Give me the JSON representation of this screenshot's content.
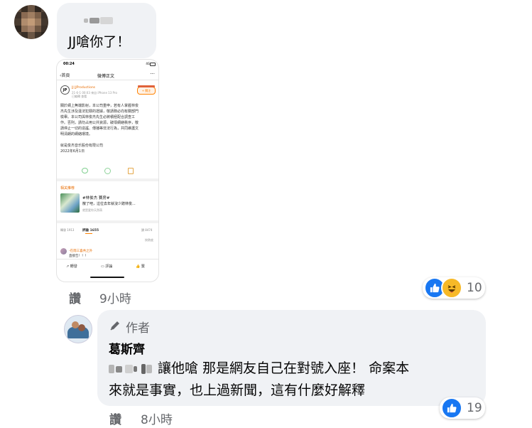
{
  "comment1": {
    "author_censored": true,
    "text": "JJ嗆你了！",
    "action_label": "讚",
    "timestamp": "9小時",
    "reaction_count": "10",
    "reaction_icons": [
      "like-icon",
      "haha-icon"
    ]
  },
  "screenshot": {
    "status_time": "00:24",
    "status_right": "4G",
    "back_label": "首頁",
    "page_title": "微博正文",
    "more_label": "···",
    "account_name": "JJ JJProductions",
    "post_meta": "21-6-1 00:03 來自 iPhone 13 Pro",
    "post_meta2": "已編輯 查看",
    "follow_label": "+ 關注",
    "body_lines": [
      "關於網上無端影射，本公司重申，若有人掌握林俊",
      "杰先生涉及違法犯罪的證據，敬請務必向有關部門",
      "檢舉。本公司與林俊杰先生必將積極配合調查工",
      "作。否則，請勿占用公共資源，破壞網絡秩序，敬",
      "請停止一切的造謠、傳播等非法行為，共同維護文",
      "明清朗的網絡環境。"
    ],
    "company": "就是俊杰音乐股份有限公司",
    "date": "2022年6月1日",
    "related_label": "相关推荐",
    "related_title": "#林俊杰 賽房#",
    "related_sub": "散了吧，這位去年就沒少蹭林俊...",
    "related_meta": "就是愛你天然萌",
    "tab_repost": "轉發 1913",
    "tab_comment": "評論 1655",
    "tab_like": "讚 8474",
    "sort_label": "按熱度",
    "comment_user": "-在雨三喜共之外",
    "comment_text": "直接告！！！",
    "bottom_repost": "轉發",
    "bottom_comment": "評論",
    "bottom_like": "贊"
  },
  "comment2": {
    "author_badge": "作者",
    "author_name": "葛斯齊",
    "text_line1": "讓他嗆 那是網友自己在對號入座！ 命案本",
    "text_line2": "來就是事實，也上過新聞，這有什麼好解釋",
    "action_label": "讚",
    "timestamp": "8小時",
    "reaction_count": "19",
    "reaction_icons": [
      "like-icon"
    ]
  },
  "colors": {
    "like_blue": "#1877f2",
    "haha_yellow": "#f7b928",
    "bubble_bg": "#f0f2f5",
    "secondary_text": "#65676b",
    "weibo_orange": "#ff8200"
  }
}
